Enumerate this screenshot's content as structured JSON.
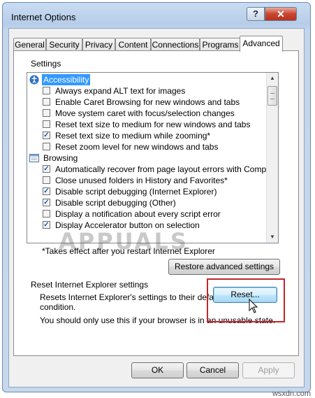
{
  "window": {
    "title": "Internet Options",
    "help_label": "?",
    "close_label": "✕"
  },
  "tabs": [
    {
      "label": "General"
    },
    {
      "label": "Security"
    },
    {
      "label": "Privacy"
    },
    {
      "label": "Content"
    },
    {
      "label": "Connections"
    },
    {
      "label": "Programs"
    },
    {
      "label": "Advanced"
    }
  ],
  "settings": {
    "group_label": "Settings",
    "rows": [
      {
        "type": "category",
        "label": "Accessibility",
        "icon": "accessibility-icon",
        "selected": true
      },
      {
        "type": "check",
        "label": "Always expand ALT text for images",
        "checked": false
      },
      {
        "type": "check",
        "label": "Enable Caret Browsing for new windows and tabs",
        "checked": false
      },
      {
        "type": "check",
        "label": "Move system caret with focus/selection changes",
        "checked": false
      },
      {
        "type": "check",
        "label": "Reset text size to medium for new windows and tabs",
        "checked": false
      },
      {
        "type": "check",
        "label": "Reset text size to medium while zooming*",
        "checked": true
      },
      {
        "type": "check",
        "label": "Reset zoom level for new windows and tabs",
        "checked": false
      },
      {
        "type": "category",
        "label": "Browsing",
        "icon": "browsing-icon",
        "selected": false
      },
      {
        "type": "check",
        "label": "Automatically recover from page layout errors with Compa",
        "checked": true
      },
      {
        "type": "check",
        "label": "Close unused folders in History and Favorites*",
        "checked": false
      },
      {
        "type": "check",
        "label": "Disable script debugging (Internet Explorer)",
        "checked": true
      },
      {
        "type": "check",
        "label": "Disable script debugging (Other)",
        "checked": true
      },
      {
        "type": "check",
        "label": "Display a notification about every script error",
        "checked": false
      },
      {
        "type": "check",
        "label": "Display Accelerator button on selection",
        "checked": true
      }
    ],
    "restart_note": "*Takes effect after you restart Internet Explorer",
    "restore_label": "Restore advanced settings"
  },
  "reset": {
    "group_label": "Reset Internet Explorer settings",
    "description_line1": "Resets Internet Explorer's settings to their default",
    "description_line2": "condition.",
    "warning": "You should only use this if your browser is in an unusable state.",
    "button_label": "Reset..."
  },
  "footer": {
    "ok_label": "OK",
    "cancel_label": "Cancel",
    "apply_label": "Apply"
  },
  "watermark": "APPUALS",
  "site_credit": "wsxdn.com"
}
